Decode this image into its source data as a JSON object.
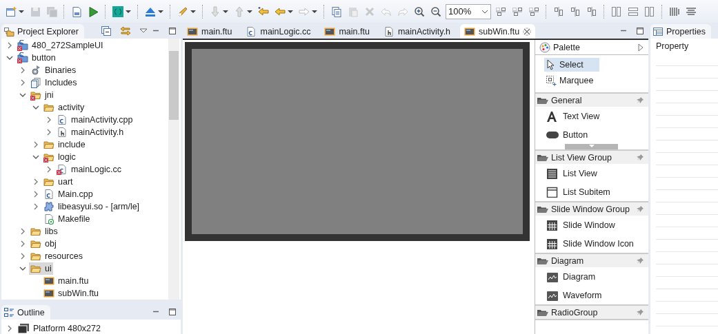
{
  "toolbar": {
    "zoom": "100%"
  },
  "explorer": {
    "title": "Project Explorer",
    "tree": [
      {
        "label": "480_272SampleUI",
        "kind": "project",
        "error": true,
        "expanded": false
      },
      {
        "label": "button",
        "kind": "project",
        "error": true,
        "expanded": true,
        "children": [
          {
            "label": "Binaries",
            "kind": "binaries",
            "expanded": false
          },
          {
            "label": "Includes",
            "kind": "includes",
            "expanded": false
          },
          {
            "label": "jni",
            "kind": "folder",
            "error": true,
            "expanded": true,
            "children": [
              {
                "label": "activity",
                "kind": "folder",
                "expanded": true,
                "children": [
                  {
                    "label": "mainActivity.cpp",
                    "kind": "source",
                    "expanded": false
                  },
                  {
                    "label": "mainActivity.h",
                    "kind": "header",
                    "expanded": false
                  }
                ]
              },
              {
                "label": "include",
                "kind": "folder",
                "expanded": false
              },
              {
                "label": "logic",
                "kind": "folder",
                "error": true,
                "expanded": true,
                "children": [
                  {
                    "label": "mainLogic.cc",
                    "kind": "source",
                    "error": true,
                    "expanded": false
                  }
                ]
              },
              {
                "label": "uart",
                "kind": "folder",
                "expanded": false
              },
              {
                "label": "Main.cpp",
                "kind": "source",
                "expanded": false
              },
              {
                "label": "libeasyui.so - [arm/le]",
                "kind": "library",
                "expanded": false
              },
              {
                "label": "Makefile",
                "kind": "makefile"
              }
            ]
          },
          {
            "label": "libs",
            "kind": "folder",
            "expanded": false
          },
          {
            "label": "obj",
            "kind": "folder",
            "expanded": false
          },
          {
            "label": "resources",
            "kind": "folder",
            "expanded": false
          },
          {
            "label": "ui",
            "kind": "folder",
            "expanded": true,
            "selected": true,
            "children": [
              {
                "label": "main.ftu",
                "kind": "ftu"
              },
              {
                "label": "subWin.ftu",
                "kind": "ftu"
              }
            ]
          }
        ]
      }
    ]
  },
  "outline": {
    "title": "Outline",
    "items": [
      {
        "label": "Platform 480x272",
        "expanded": false
      }
    ]
  },
  "tabs": [
    {
      "label": "main.ftu",
      "kind": "ftu",
      "selected": false
    },
    {
      "label": "mainLogic.cc",
      "kind": "source",
      "selected": false
    },
    {
      "label": "main.ftu",
      "kind": "ftu",
      "selected": false
    },
    {
      "label": "mainActivity.h",
      "kind": "header",
      "selected": false
    },
    {
      "label": "subWin.ftu",
      "kind": "ftu",
      "selected": true
    }
  ],
  "palette": {
    "title": "Palette",
    "tools": [
      {
        "label": "Select",
        "kind": "select",
        "selected": true
      },
      {
        "label": "Marquee",
        "kind": "marquee",
        "selected": false
      }
    ],
    "drawers": [
      {
        "label": "General",
        "clipped": true,
        "items": [
          {
            "label": "Text View",
            "kind": "text"
          },
          {
            "label": "Button",
            "kind": "button"
          }
        ]
      },
      {
        "label": "List View Group",
        "items": [
          {
            "label": "List View",
            "kind": "list"
          },
          {
            "label": "List Subitem",
            "kind": "subitem"
          }
        ]
      },
      {
        "label": "Slide Window Group",
        "items": [
          {
            "label": "Slide Window",
            "kind": "grid"
          },
          {
            "label": "Slide Window Icon",
            "kind": "grid"
          }
        ]
      },
      {
        "label": "Diagram",
        "items": [
          {
            "label": "Diagram",
            "kind": "chart"
          },
          {
            "label": "Waveform",
            "kind": "chart"
          }
        ]
      },
      {
        "label": "RadioGroup"
      }
    ]
  },
  "properties": {
    "title": "Properties",
    "column": "Property"
  }
}
